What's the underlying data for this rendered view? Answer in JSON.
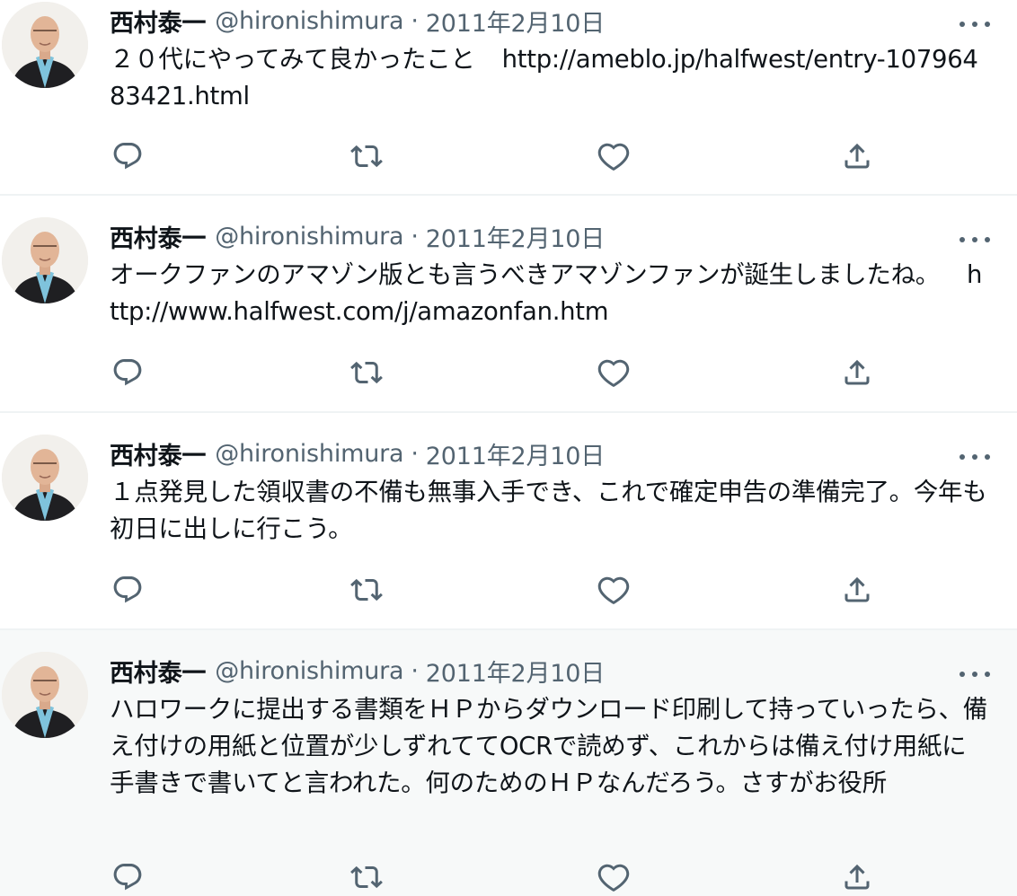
{
  "colors": {
    "text": "#0f1419",
    "secondary": "#536471",
    "divider": "#eff3f4",
    "highlight_bg": "#f7f9f9"
  },
  "icons": {
    "reply": "reply-icon",
    "retweet": "retweet-icon",
    "like": "heart-icon",
    "share": "share-icon",
    "more": "more-icon"
  },
  "tweets": [
    {
      "name": "西村泰一",
      "handle": "@hironishimura",
      "separator": "·",
      "date": "2011年2月10日",
      "text": "２０代にやってみて良かったこと",
      "link": "http://ameblo.jp/halfwest/entry-10796483421.html"
    },
    {
      "name": "西村泰一",
      "handle": "@hironishimura",
      "separator": "·",
      "date": "2011年2月10日",
      "text": "オークファンのアマゾン版とも言うべきアマゾンファンが誕生しましたね。",
      "link": "http://www.halfwest.com/j/amazonfan.htm"
    },
    {
      "name": "西村泰一",
      "handle": "@hironishimura",
      "separator": "·",
      "date": "2011年2月10日",
      "text": "１点発見した領収書の不備も無事入手でき、これで確定申告の準備完了。今年も初日に出しに行こう。"
    },
    {
      "name": "西村泰一",
      "handle": "@hironishimura",
      "separator": "·",
      "date": "2011年2月10日",
      "text": "ハロワークに提出する書類をＨＰからダウンロード印刷して持っていったら、備え付けの用紙と位置が少しずれててOCRで読めず、これからは備え付け用紙に手書きで書いてと言われた。何のためのＨＰなんだろう。さすがお役所"
    }
  ]
}
